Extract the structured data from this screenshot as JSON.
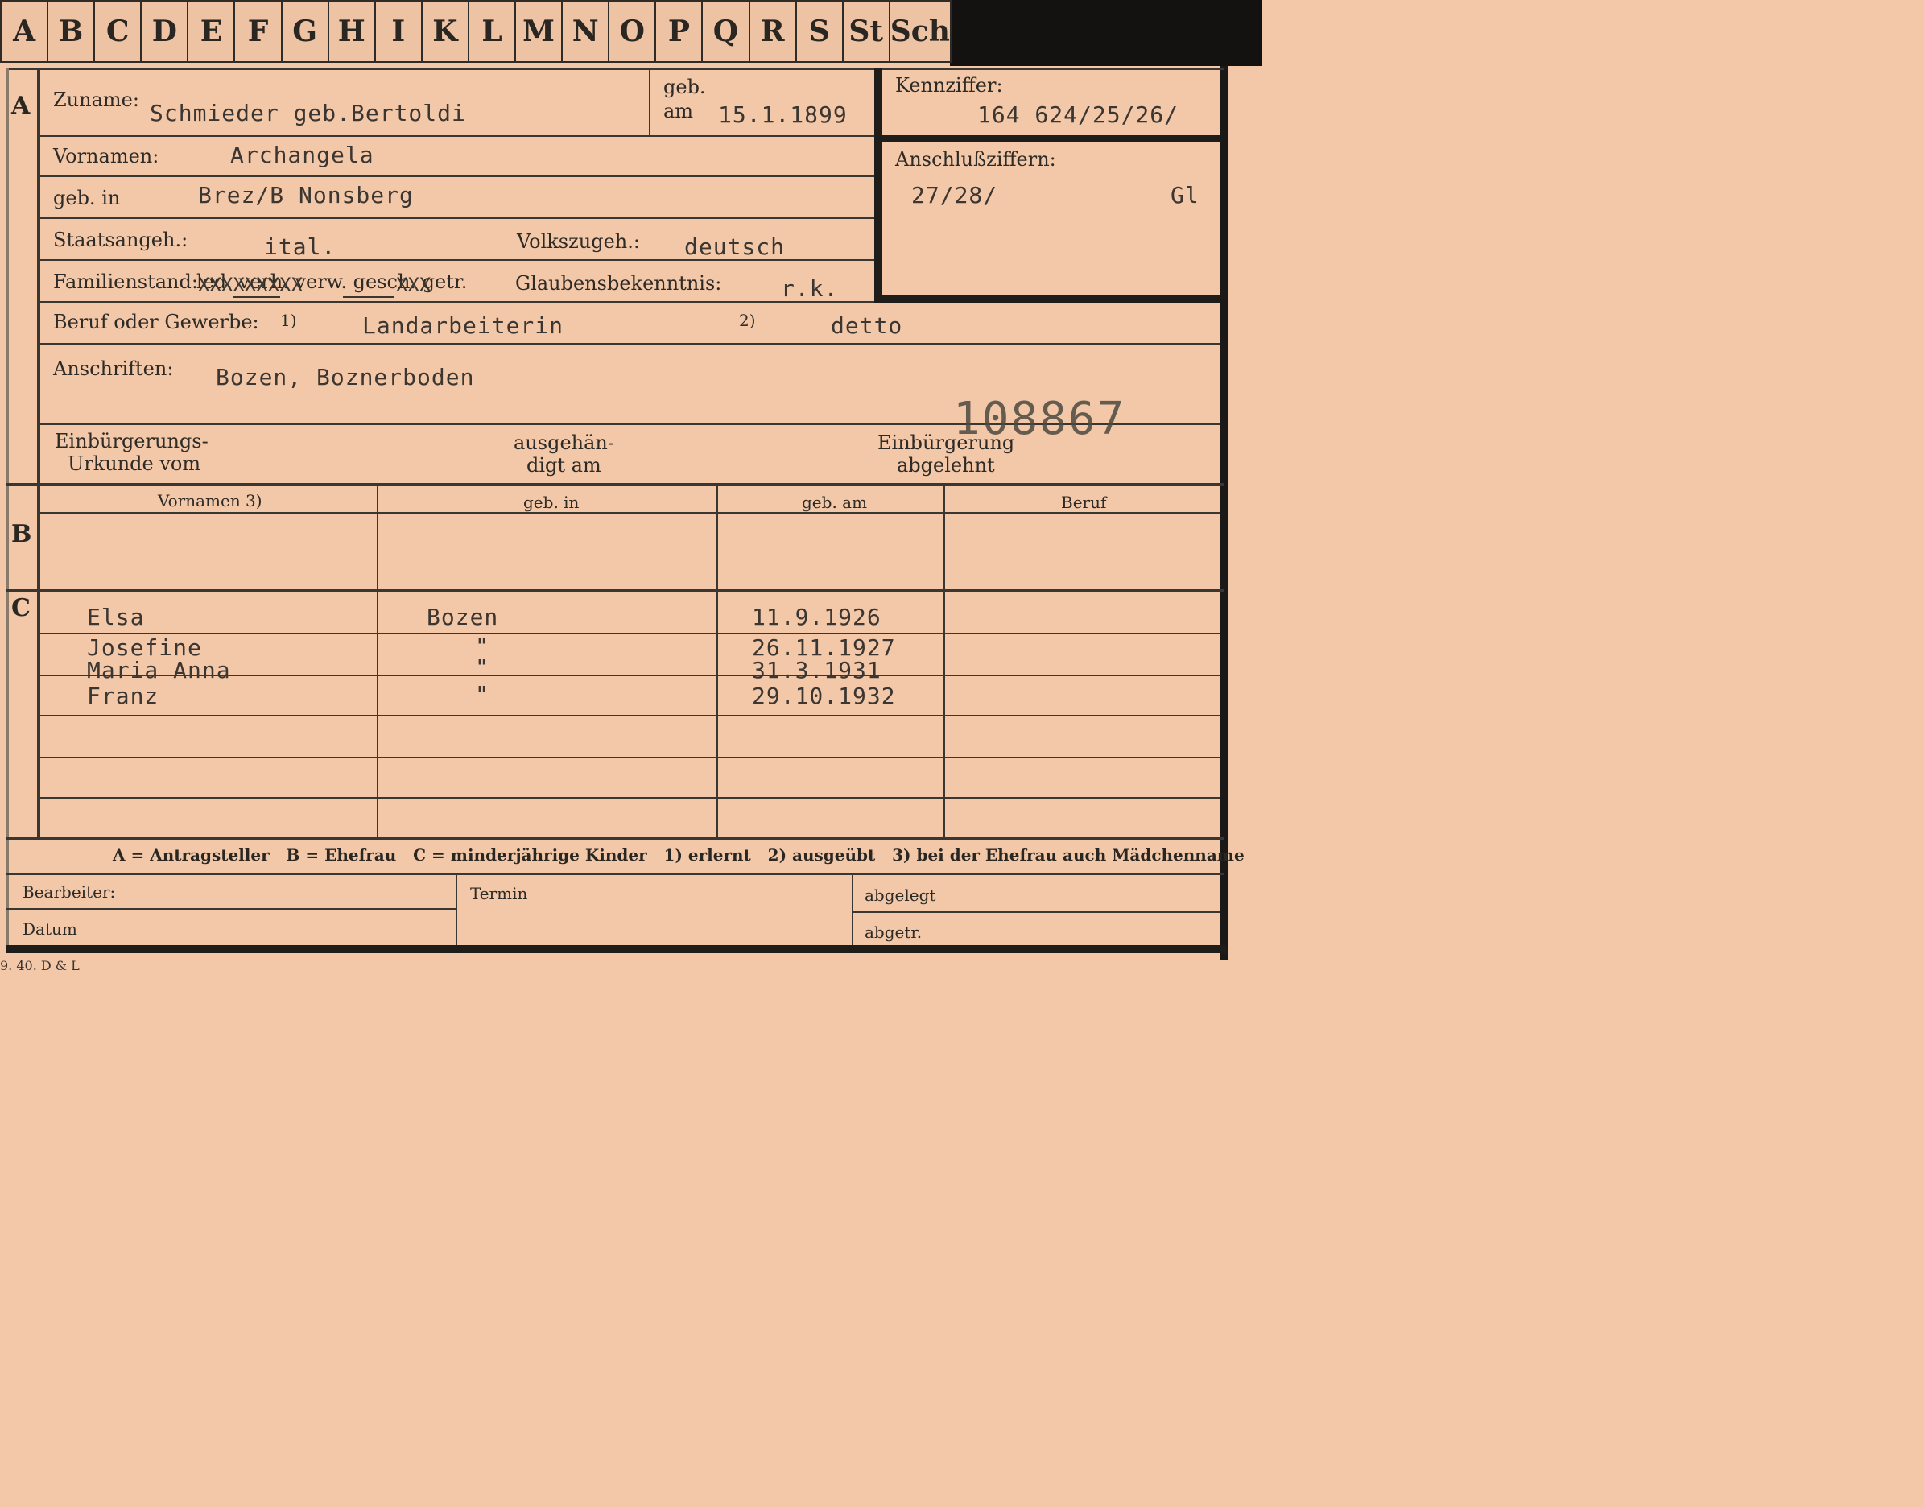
{
  "tabs": [
    "A",
    "B",
    "C",
    "D",
    "E",
    "F",
    "G",
    "H",
    "I",
    "K",
    "L",
    "M",
    "N",
    "O",
    "P",
    "Q",
    "R",
    "S",
    "St",
    "Sch"
  ],
  "sections": {
    "a": "A",
    "b": "B",
    "c": "C"
  },
  "labels": {
    "zuname": "Zuname:",
    "geb_am_1": "geb.",
    "geb_am_2": "am",
    "kennziffer": "Kennziffer:",
    "vornamen": "Vornamen:",
    "anschlussziffern": "Anschlußziffern:",
    "geb_in": "geb. in",
    "staatsangeh": "Staatsangeh.:",
    "volkszugeh": "Volkszugeh.:",
    "familienstand": "Familienstand:",
    "familienstand_options": "led. verh. verw. gesch. getr.",
    "glaubensbekenntnis": "Glaubensbekenntnis:",
    "beruf": "Beruf oder Gewerbe:",
    "beruf_note1": "1)",
    "beruf_note2": "2)",
    "anschriften": "Anschriften:",
    "einbuergerung_1": "Einbürgerungs-",
    "einbuergerung_2": "Urkunde vom",
    "ausgehaendigt_1": "ausgehän-",
    "ausgehaendigt_2": "digt am",
    "abgelehnt_1": "Einbürgerung",
    "abgelehnt_2": "abgelehnt"
  },
  "values": {
    "zuname": "Schmieder geb.Bertoldi",
    "geb_am": "15.1.1899",
    "kennziffer": "164 624/25/26/",
    "vornamen": "Archangela",
    "anschlussziffern": "27/28/",
    "anschluss_code": "Gl",
    "geb_in": "Brez/B Nonsberg",
    "staatsangeh": "ital.",
    "volkszugeh": "deutsch",
    "familienstand_mark": "XXXXXXXXX",
    "familienstand_mark2": "XXX",
    "glaubensbekenntnis": "r.k.",
    "beruf_erlernt": "Landarbeiterin",
    "beruf_ausgeuebt": "detto",
    "anschriften": "Bozen, Boznerboden",
    "stamp_number": "108867"
  },
  "table_headers": [
    "Vornamen 3)",
    "geb. in",
    "geb. am",
    "Beruf"
  ],
  "children": [
    {
      "name": "Elsa",
      "place": "Bozen",
      "date": "11.9.1926"
    },
    {
      "name": "Josefine",
      "place": "\"",
      "date": "26.11.1927"
    },
    {
      "name": "Maria Anna",
      "place": "\"",
      "date": "31.3.1931"
    },
    {
      "name": "Franz",
      "place": "\"",
      "date": "29.10.1932"
    }
  ],
  "legend": "A = Antragsteller   B = Ehefrau   C = minderjährige Kinder   1) erlernt   2) ausgeübt   3) bei der Ehefrau auch Mädchenname",
  "footer": {
    "bearbeiter": "Bearbeiter:",
    "datum": "Datum",
    "termin": "Termin",
    "abgelegt": "abgelegt",
    "abgetr": "abgetr."
  },
  "printmark": "9. 40. D & L"
}
